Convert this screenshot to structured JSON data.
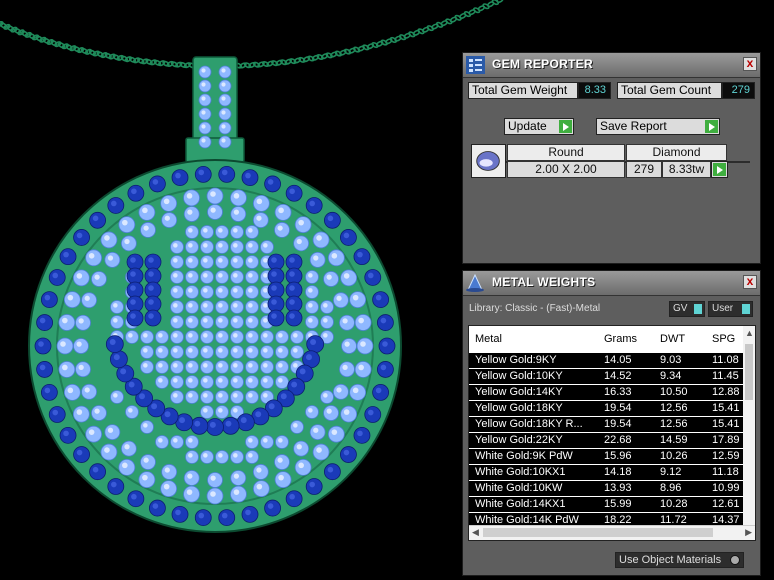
{
  "gem_reporter": {
    "title": "GEM REPORTER",
    "close": "x",
    "total_gem_weight_label": "Total Gem Weight",
    "total_gem_weight_value": "8.33",
    "total_gem_count_label": "Total Gem Count",
    "total_gem_count_value": "279",
    "update_label": "Update",
    "save_report_label": "Save Report",
    "gem": {
      "shape": "Round",
      "size": "2.00 X 2.00",
      "material": "Diamond",
      "count": "279",
      "weight": "8.33tw"
    }
  },
  "metal_weights": {
    "title": "METAL WEIGHTS",
    "close": "x",
    "library": "Library: Classic - (Fast)-Metal",
    "gv_label": "GV",
    "user_label": "User",
    "columns": [
      "Metal",
      "Grams",
      "DWT",
      "SPG"
    ],
    "rows": [
      [
        "Yellow Gold:9KY",
        "14.05",
        "9.03",
        "11.08"
      ],
      [
        "Yellow Gold:10KY",
        "14.52",
        "9.34",
        "11.45"
      ],
      [
        "Yellow Gold:14KY",
        "16.33",
        "10.50",
        "12.88"
      ],
      [
        "Yellow Gold:18KY",
        "19.54",
        "12.56",
        "15.41"
      ],
      [
        "Yellow Gold:18KY R...",
        "19.54",
        "12.56",
        "15.41"
      ],
      [
        "Yellow Gold:22KY",
        "22.68",
        "14.59",
        "17.89"
      ],
      [
        "White Gold:9K PdW",
        "15.96",
        "10.26",
        "12.59"
      ],
      [
        "White Gold:10KX1",
        "14.18",
        "9.12",
        "11.18"
      ],
      [
        "White Gold:10KW",
        "13.93",
        "8.96",
        "10.99"
      ],
      [
        "White Gold:14KX1",
        "15.99",
        "10.28",
        "12.61"
      ],
      [
        "White Gold:14K PdW",
        "18.22",
        "11.72",
        "14.37"
      ]
    ],
    "use_object_materials_label": "Use Object Materials"
  },
  "colors": {
    "metal_green": "#2e9e6e",
    "chain_green": "#1f8a5a",
    "gem_light_blue": "#8fb8ff",
    "gem_dark_blue": "#1a3ab8",
    "panel_gray": "#5e5e5e",
    "accent_cyan": "#5fd4d4"
  }
}
